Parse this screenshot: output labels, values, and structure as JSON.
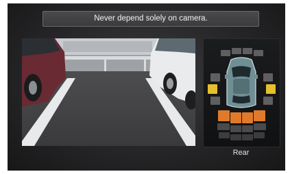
{
  "banner": {
    "text": "Never depend solely on camera."
  },
  "camera": {
    "view_label": "Rear"
  },
  "sensors": {
    "front": [
      "inactive",
      "inactive",
      "inactive",
      "inactive"
    ],
    "left": [
      "inactive",
      "active-yellow",
      "inactive"
    ],
    "right": [
      "inactive",
      "active-yellow",
      "inactive"
    ],
    "rear": [
      "active-orange",
      "active-orange",
      "active-orange",
      "active-orange"
    ]
  },
  "colors": {
    "inactive": "#5f5f61",
    "active-yellow": "#e5c02c",
    "active-orange": "#e07a2a",
    "car_body": "#6f8f95"
  }
}
